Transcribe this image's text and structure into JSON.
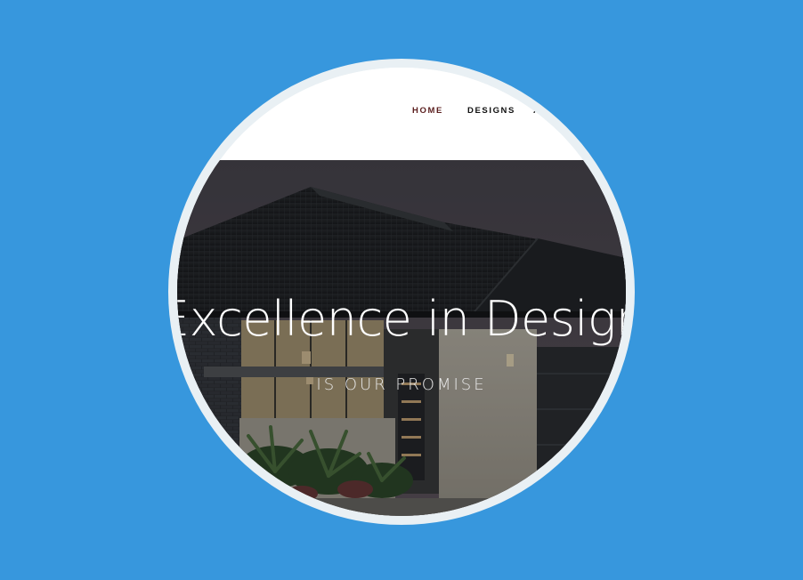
{
  "nav": {
    "items": [
      {
        "label": "HOME",
        "state": "active"
      },
      {
        "label": "DESIGNS"
      },
      {
        "label": "A"
      }
    ]
  },
  "hero": {
    "headline": "Excellence in Design",
    "subline": "IS OUR PROMISE"
  },
  "colors": {
    "background": "#3797dd",
    "ring": "#e9f0f4",
    "nav_active": "#5b1f1f",
    "nav_text": "#111111"
  }
}
